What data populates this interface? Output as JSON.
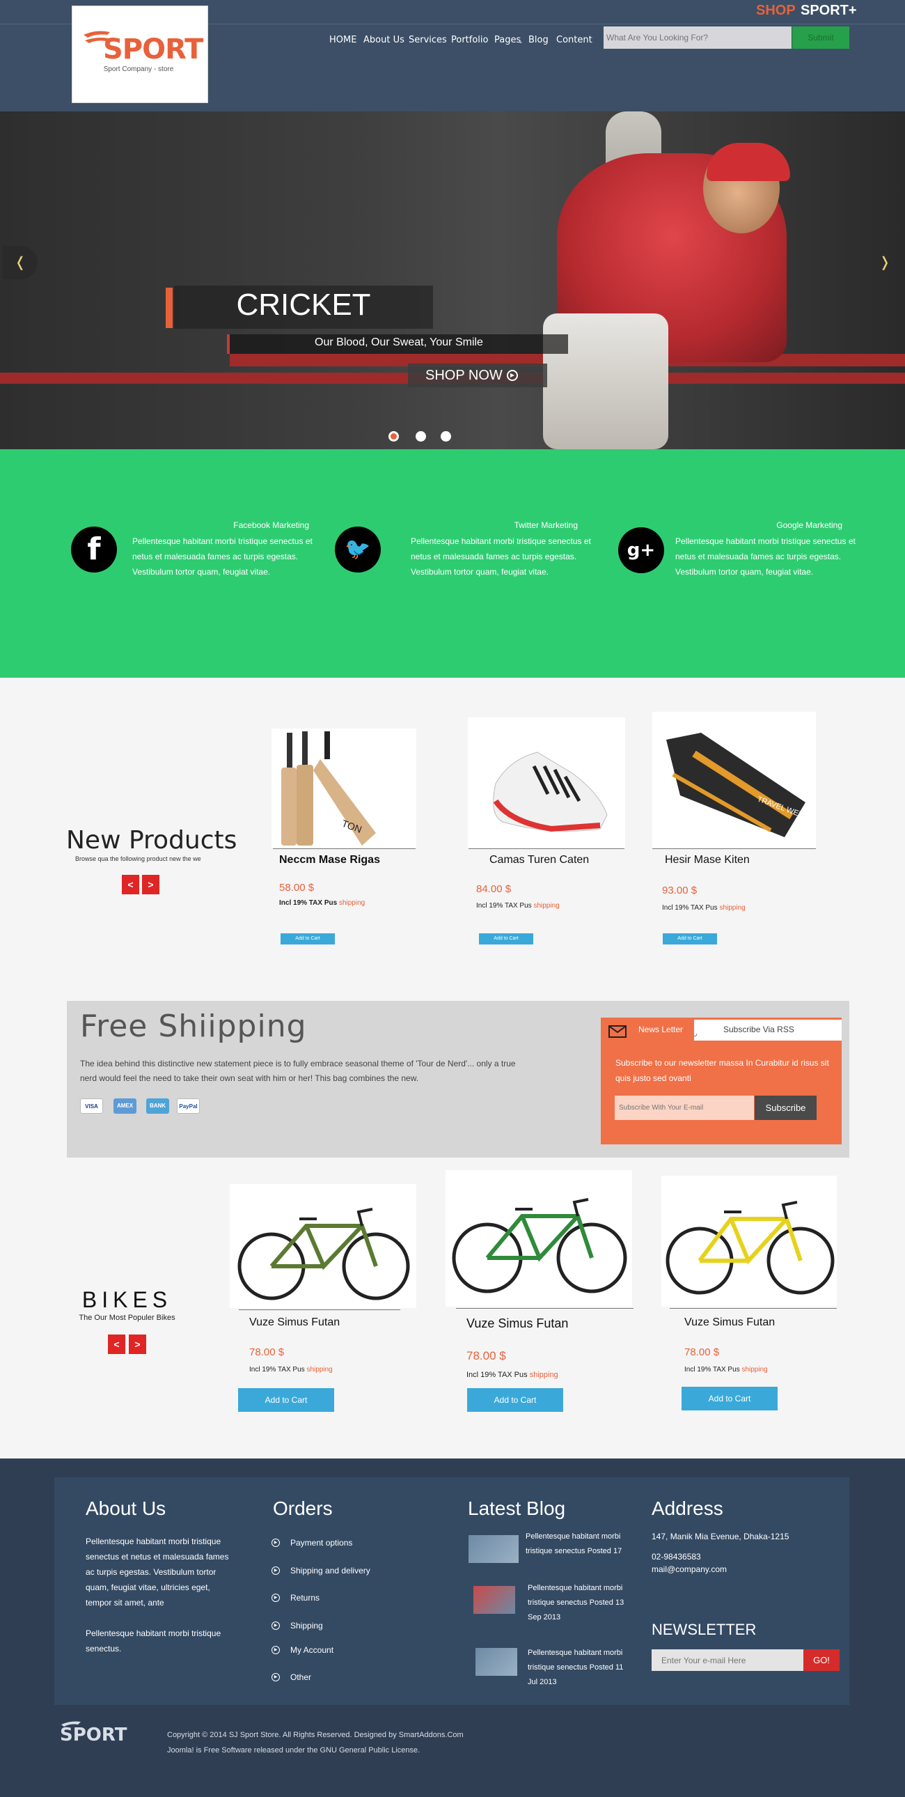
{
  "header": {
    "logo_text": "SPORT",
    "logo_tagline": "Sport Company - store",
    "brand_shop": "SHOP",
    "brand_sport": "SPORT+",
    "nav": [
      "HOME",
      "About Us",
      "Services",
      "Portfolio",
      "Pages",
      "Blog",
      "Content"
    ],
    "search_placeholder": "What Are You Looking For?",
    "search_button": "Submit"
  },
  "hero": {
    "title": "CRICKET",
    "tagline": "Our Blood, Our Sweat, Your Smile",
    "cta": "SHOP NOW",
    "prev": "❬",
    "next": "❭"
  },
  "social": [
    {
      "title": "Facebook Marketing",
      "text": "Pellentesque habitant morbi tristique senectus et netus et malesuada fames ac turpis egestas. Vestibulum tortor quam, feugiat vitae.",
      "icon": "f"
    },
    {
      "title": "Twitter Marketing",
      "text": "Pellentesque habitant morbi tristique senectus et netus et malesuada fames ac turpis egestas. Vestibulum tortor quam, feugiat vitae.",
      "icon": "🐦"
    },
    {
      "title": "Google Marketing",
      "text": "Pellentesque habitant morbi tristique senectus et netus et malesuada fames ac turpis egestas. Vestibulum tortor quam, feugiat vitae.",
      "icon": "g+"
    }
  ],
  "new_products": {
    "title": "New Products",
    "subtitle": "Browse qua the following product new the we",
    "items": [
      {
        "name": "Neccm Mase Rigas",
        "price": "58.00 $",
        "tax": "Incl 19% TAX Pus ",
        "shipping": "shipping",
        "cart": "Add to Cart"
      },
      {
        "name": "Camas Turen Caten",
        "price": "84.00 $",
        "tax": "Incl 19% TAX Pus ",
        "shipping": "shipping",
        "cart": "Add to Cart"
      },
      {
        "name": "Hesir Mase Kiten",
        "price": "93.00 $",
        "tax": "Incl 19% TAX Pus ",
        "shipping": "shipping",
        "cart": "Add to Cart"
      }
    ]
  },
  "shipping": {
    "title": "Free  Shiipping",
    "text": "The idea behind this distinctive new statement piece is to fully embrace seasonal theme of 'Tour de Nerd'... only a true nerd would feel the need to take their own seat with him or her! This bag combines the new.",
    "payments": [
      "VISA",
      "AMEX",
      "BANK",
      "PayPal"
    ]
  },
  "newsletter_box": {
    "tab": "News Letter",
    "rss_tab": "Subscribe Via RSS",
    "text": "Subscribe to our newsletter massa In Curabitur id risus sit quis justo sed ovanti",
    "placeholder": "Subscribe With Your E-mail",
    "button": "Subscribe"
  },
  "bikes": {
    "title": "BIKES",
    "subtitle": "The Our Most Populer Bikes",
    "items": [
      {
        "name": "Vuze Simus Futan",
        "price": "78.00 $",
        "tax": "Incl 19% TAX Pus ",
        "shipping": "shipping",
        "cart": "Add  to Cart",
        "frame_color": "#5a7a32"
      },
      {
        "name": "Vuze Simus Futan",
        "price": "78.00 $",
        "tax": "Incl 19% TAX Pus ",
        "shipping": "shipping",
        "cart": "Add  to Cart",
        "frame_color": "#2f8a3a"
      },
      {
        "name": "Vuze Simus Futan",
        "price": "78.00 $",
        "tax": "Incl 19% TAX Pus ",
        "shipping": "shipping",
        "cart": "Add  to Cart",
        "frame_color": "#e6d21c"
      }
    ]
  },
  "footer": {
    "about_title": "About Us",
    "about_text1": "Pellentesque habitant morbi tristique senectus et netus et malesuada fames ac turpis egestas. Vestibulum tortor quam, feugiat vitae, ultricies eget, tempor sit amet, ante",
    "about_text2": "Pellentesque habitant morbi tristique senectus.",
    "orders_title": "Orders",
    "orders": [
      "Payment options",
      "Shipping and delivery",
      "Returns",
      "Shipping",
      "My Account",
      "Other"
    ],
    "blog_title": "Latest Blog",
    "blog": [
      "Pellentesque habitant morbi tristique senectus Posted 17",
      "Pellentesque habitant morbi tristique senectus Posted 13 Sep 2013",
      "Pellentesque habitant morbi tristique senectus Posted 11 Jul 2013"
    ],
    "address_title": "Address",
    "address": "147, Manik Mia Evenue, Dhaka-1215",
    "phone": "02-98436583",
    "email": "mail@company.com",
    "newsletter_title": "NEWSLETTER",
    "newsletter_placeholder": "Enter Your e-mail Here",
    "newsletter_button": "GO!",
    "logo": "SPORT",
    "copyright1": "Copyright © 2014 SJ Sport Store. All Rights Reserved. Designed by SmartAddons.Com",
    "copyright2": "Joomla! is Free Software released under the GNU General Public License."
  },
  "colors": {
    "accent": "#e8613a",
    "green": "#2ecc71",
    "header": "#3c4f66",
    "footer": "#2f3e52",
    "cart": "#3aa9d9"
  }
}
